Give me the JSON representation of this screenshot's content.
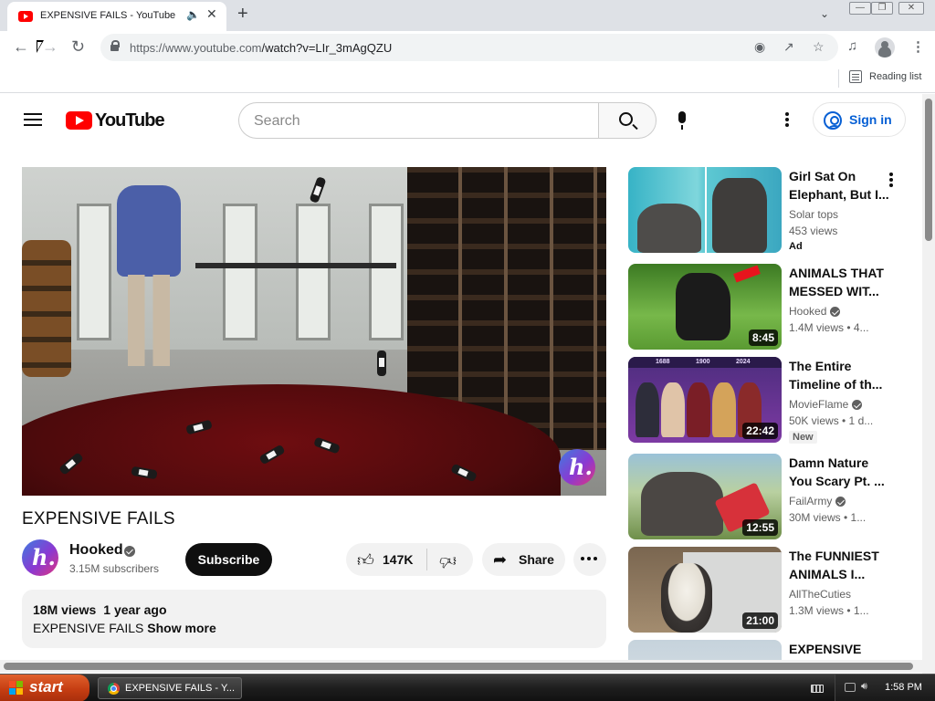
{
  "browser": {
    "tab": {
      "title": "EXPENSIVE FAILS - YouTube",
      "favicon": "youtube-icon",
      "audio_icon": "speaker-icon"
    },
    "url": {
      "origin": "https://www.youtube.com",
      "path": "/watch?v=LIr_3mAgQZU"
    },
    "bookmarks": {
      "reading_list": "Reading list"
    }
  },
  "youtube": {
    "logo_text": "YouTube",
    "search_placeholder": "Search",
    "sign_in": "Sign in",
    "video": {
      "title": "EXPENSIVE FAILS",
      "channel": "Hooked",
      "subscribers": "3.15M subscribers",
      "subscribe_label": "Subscribe",
      "likes": "147K",
      "share_label": "Share",
      "views": "18M views",
      "age": "1 year ago",
      "description": "EXPENSIVE FAILS",
      "show_more": "Show more"
    },
    "related": [
      {
        "title": "Girl Sat On Elephant, But I...",
        "channel": "Solar tops",
        "meta": "453 views",
        "badge": "Ad",
        "duration": ""
      },
      {
        "title": "ANIMALS THAT MESSED WIT...",
        "channel": "Hooked",
        "meta": "1.4M views  • 4...",
        "badge": "",
        "duration": "8:45",
        "verified": true
      },
      {
        "title": "The Entire Timeline of th...",
        "channel": "MovieFlame",
        "meta": "50K views  • 1 d...",
        "badge": "New",
        "duration": "22:42",
        "verified": true
      },
      {
        "title": "Damn Nature You Scary Pt. ...",
        "channel": "FailArmy",
        "meta": "30M views  • 1...",
        "badge": "",
        "duration": "12:55",
        "verified": true
      },
      {
        "title": "The FUNNIEST ANIMALS I...",
        "channel": "AllTheCuties",
        "meta": "1.3M views  • 1...",
        "badge": "",
        "duration": "21:00"
      },
      {
        "title": "EXPENSIVE",
        "channel": "",
        "meta": "",
        "badge": "",
        "duration": ""
      }
    ],
    "thumb3_years": {
      "a": "1688",
      "b": "1900",
      "c": "2024"
    }
  },
  "taskbar": {
    "start_label": "start",
    "task_label": "EXPENSIVE FAILS - Y...",
    "clock": "1:58 PM"
  },
  "colors": {
    "youtube_red": "#ff0000",
    "link_blue": "#065fd4",
    "xp_start": "#c53d12"
  }
}
